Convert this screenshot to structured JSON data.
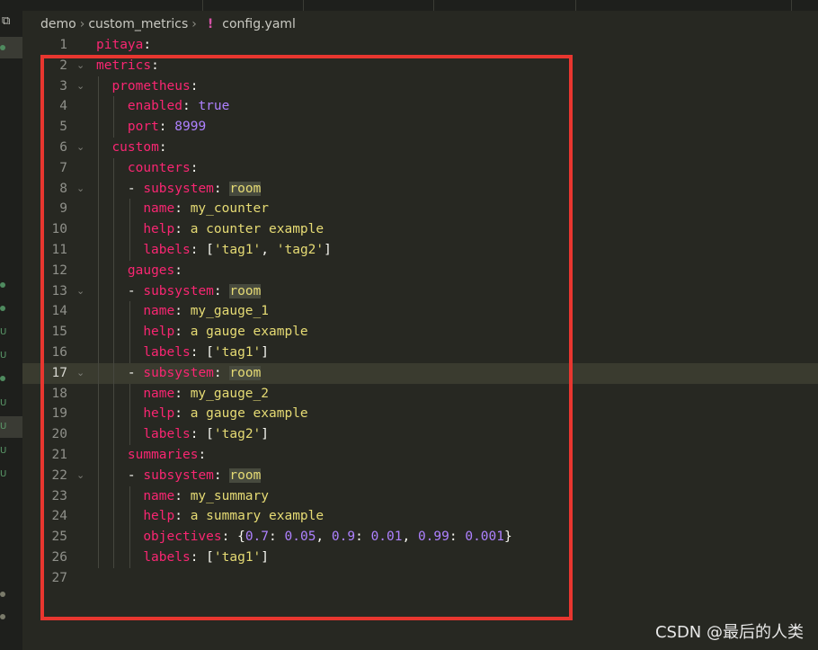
{
  "breadcrumb": {
    "folder1": "demo",
    "folder2": "custom_metrics",
    "file_icon": "!",
    "file": "config.yaml"
  },
  "icons": {
    "explorer": "copy-icon"
  },
  "current_line": 17,
  "lines": [
    {
      "n": "1",
      "ind": 0,
      "fold": false,
      "toks": [
        [
          "k",
          "pitaya"
        ],
        [
          "w",
          ":"
        ]
      ]
    },
    {
      "n": "2",
      "ind": 0,
      "fold": true,
      "toks": [
        [
          "k",
          "metrics"
        ],
        [
          "w",
          ":"
        ]
      ]
    },
    {
      "n": "3",
      "ind": 1,
      "fold": true,
      "toks": [
        [
          "k",
          "prometheus"
        ],
        [
          "w",
          ":"
        ]
      ]
    },
    {
      "n": "4",
      "ind": 2,
      "fold": false,
      "toks": [
        [
          "k",
          "enabled"
        ],
        [
          "w",
          ": "
        ],
        [
          "b",
          "true"
        ]
      ]
    },
    {
      "n": "5",
      "ind": 2,
      "fold": false,
      "toks": [
        [
          "k",
          "port"
        ],
        [
          "w",
          ": "
        ],
        [
          "b",
          "8999"
        ]
      ]
    },
    {
      "n": "6",
      "ind": 1,
      "fold": true,
      "toks": [
        [
          "k",
          "custom"
        ],
        [
          "w",
          ":"
        ]
      ]
    },
    {
      "n": "7",
      "ind": 2,
      "fold": false,
      "toks": [
        [
          "k",
          "counters"
        ],
        [
          "w",
          ":"
        ]
      ]
    },
    {
      "n": "8",
      "ind": 2,
      "fold": true,
      "toks": [
        [
          "w",
          "- "
        ],
        [
          "k",
          "subsystem"
        ],
        [
          "w",
          ": "
        ],
        [
          "vh",
          "room"
        ]
      ]
    },
    {
      "n": "9",
      "ind": 3,
      "fold": false,
      "toks": [
        [
          "k",
          "name"
        ],
        [
          "w",
          ": "
        ],
        [
          "v",
          "my_counter"
        ]
      ]
    },
    {
      "n": "10",
      "ind": 3,
      "fold": false,
      "toks": [
        [
          "k",
          "help"
        ],
        [
          "w",
          ": "
        ],
        [
          "v",
          "a counter example"
        ]
      ]
    },
    {
      "n": "11",
      "ind": 3,
      "fold": false,
      "toks": [
        [
          "k",
          "labels"
        ],
        [
          "w",
          ": ["
        ],
        [
          "v",
          "'tag1'"
        ],
        [
          "w",
          ", "
        ],
        [
          "v",
          "'tag2'"
        ],
        [
          "w",
          "]"
        ]
      ]
    },
    {
      "n": "12",
      "ind": 2,
      "fold": false,
      "toks": [
        [
          "k",
          "gauges"
        ],
        [
          "w",
          ":"
        ]
      ]
    },
    {
      "n": "13",
      "ind": 2,
      "fold": true,
      "toks": [
        [
          "w",
          "- "
        ],
        [
          "k",
          "subsystem"
        ],
        [
          "w",
          ": "
        ],
        [
          "vh",
          "room"
        ]
      ]
    },
    {
      "n": "14",
      "ind": 3,
      "fold": false,
      "toks": [
        [
          "k",
          "name"
        ],
        [
          "w",
          ": "
        ],
        [
          "v",
          "my_gauge_1"
        ]
      ]
    },
    {
      "n": "15",
      "ind": 3,
      "fold": false,
      "toks": [
        [
          "k",
          "help"
        ],
        [
          "w",
          ": "
        ],
        [
          "v",
          "a gauge example"
        ]
      ]
    },
    {
      "n": "16",
      "ind": 3,
      "fold": false,
      "toks": [
        [
          "k",
          "labels"
        ],
        [
          "w",
          ": ["
        ],
        [
          "v",
          "'tag1'"
        ],
        [
          "w",
          "]"
        ]
      ]
    },
    {
      "n": "17",
      "ind": 2,
      "fold": true,
      "toks": [
        [
          "w",
          "- "
        ],
        [
          "k",
          "subsystem"
        ],
        [
          "w",
          ": "
        ],
        [
          "vh",
          "room"
        ]
      ]
    },
    {
      "n": "18",
      "ind": 3,
      "fold": false,
      "toks": [
        [
          "k",
          "name"
        ],
        [
          "w",
          ": "
        ],
        [
          "v",
          "my_gauge_2"
        ]
      ]
    },
    {
      "n": "19",
      "ind": 3,
      "fold": false,
      "toks": [
        [
          "k",
          "help"
        ],
        [
          "w",
          ": "
        ],
        [
          "v",
          "a gauge example"
        ]
      ]
    },
    {
      "n": "20",
      "ind": 3,
      "fold": false,
      "toks": [
        [
          "k",
          "labels"
        ],
        [
          "w",
          ": ["
        ],
        [
          "v",
          "'tag2'"
        ],
        [
          "w",
          "]"
        ]
      ]
    },
    {
      "n": "21",
      "ind": 2,
      "fold": false,
      "toks": [
        [
          "k",
          "summaries"
        ],
        [
          "w",
          ":"
        ]
      ]
    },
    {
      "n": "22",
      "ind": 2,
      "fold": true,
      "toks": [
        [
          "w",
          "- "
        ],
        [
          "k",
          "subsystem"
        ],
        [
          "w",
          ": "
        ],
        [
          "vh",
          "room"
        ]
      ]
    },
    {
      "n": "23",
      "ind": 3,
      "fold": false,
      "toks": [
        [
          "k",
          "name"
        ],
        [
          "w",
          ": "
        ],
        [
          "v",
          "my_summary"
        ]
      ]
    },
    {
      "n": "24",
      "ind": 3,
      "fold": false,
      "toks": [
        [
          "k",
          "help"
        ],
        [
          "w",
          ": "
        ],
        [
          "v",
          "a summary example"
        ]
      ]
    },
    {
      "n": "25",
      "ind": 3,
      "fold": false,
      "toks": [
        [
          "k",
          "objectives"
        ],
        [
          "w",
          ": {"
        ],
        [
          "b",
          "0.7"
        ],
        [
          "w",
          ": "
        ],
        [
          "b",
          "0.05"
        ],
        [
          "w",
          ", "
        ],
        [
          "b",
          "0.9"
        ],
        [
          "w",
          ": "
        ],
        [
          "b",
          "0.01"
        ],
        [
          "w",
          ", "
        ],
        [
          "b",
          "0.99"
        ],
        [
          "w",
          ": "
        ],
        [
          "b",
          "0.001"
        ],
        [
          "w",
          "}"
        ]
      ]
    },
    {
      "n": "26",
      "ind": 3,
      "fold": false,
      "toks": [
        [
          "k",
          "labels"
        ],
        [
          "w",
          ": ["
        ],
        [
          "v",
          "'tag1'"
        ],
        [
          "w",
          "]"
        ]
      ]
    },
    {
      "n": "27",
      "ind": 0,
      "fold": false,
      "toks": []
    }
  ],
  "watermark": "CSDN @最后的人类",
  "colors": {
    "background": "#272822",
    "key": "#f92672",
    "string": "#e6db74",
    "number": "#ae81ff",
    "annotation_box": "#e8362f"
  }
}
